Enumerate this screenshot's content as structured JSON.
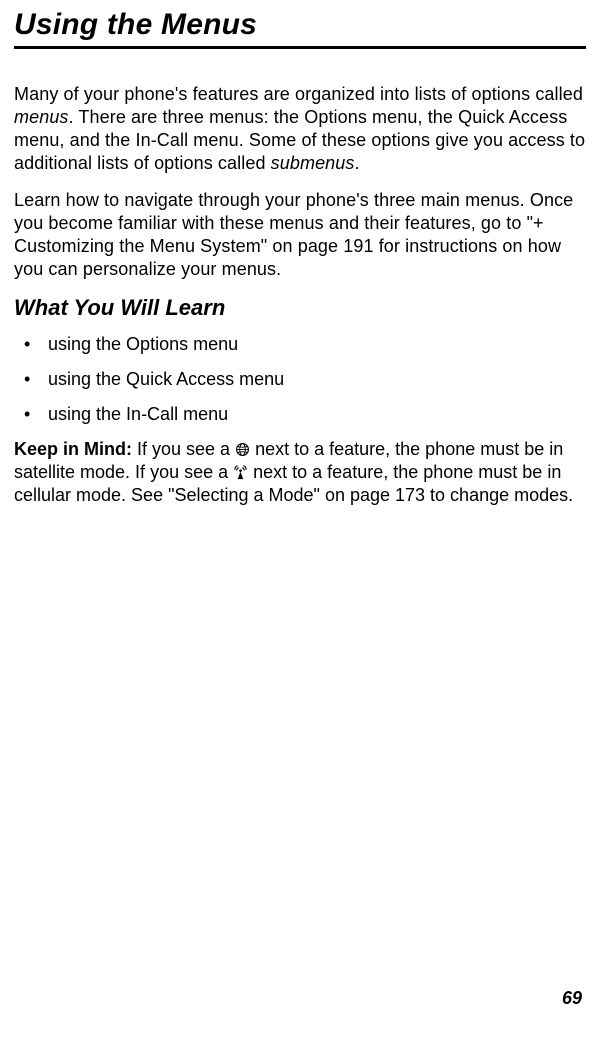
{
  "chapterTitle": "Using the Menus",
  "para1_pre": "Many of your phone's features are organized into lists of options called ",
  "para1_menus": "menus",
  "para1_mid": ". There are three menus: the Options menu, the Quick Access menu, and the In-Call menu. Some of these options give you access to additional lists of options called ",
  "para1_submenus": "submenus",
  "para1_end": ".",
  "para2": "Learn how to navigate through your phone's three main menus. Once you become familiar with these menus and their features, go to \"+ Customizing the Menu System\" on page 191 for instructions on how you can personalize your menus.",
  "sectionTitle": "What You Will Learn",
  "bullets": {
    "0": "using the Options menu",
    "1": "using the Quick Access menu",
    "2": "using the In-Call menu"
  },
  "keep_label": "Keep in Mind:",
  "keep_1": " If you see a ",
  "keep_2": " next to a feature, the phone must be in satellite mode. If you see a ",
  "keep_3": " next to a feature, the phone must be in cellular mode. See \"Selecting a Mode\" on page 173 to change modes.",
  "pageNumber": "69"
}
